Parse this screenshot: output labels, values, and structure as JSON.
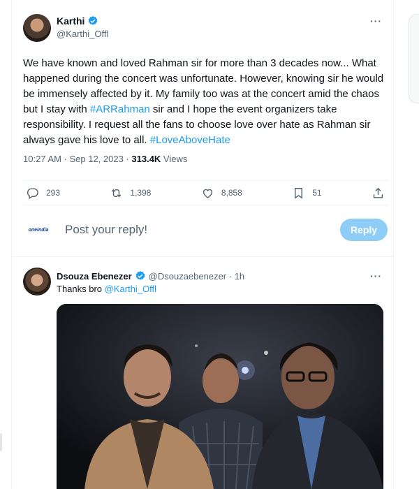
{
  "tweet": {
    "author_name": "Karthi",
    "handle": "@Karthi_Offl",
    "text_parts": [
      "We have known and loved Rahman sir for more than 3 decades now... What happened during the concert was unfortunate. However, knowing sir he would be immensely affected by it. My family too was at the concert amid the chaos but I stay with ",
      "#ARRahman",
      " sir and I hope the event organizers take responsibility. I request all the fans to choose love over hate as Rahman sir always gave his love to all. ",
      "#LoveAboveHate"
    ],
    "timestamp": "10:27 AM · Sep 12, 2023 · ",
    "views": "313.4K",
    "views_label": " Views",
    "more": "···",
    "actions": {
      "replies": "293",
      "reposts": "1,398",
      "likes": "8,858",
      "bookmarks": "51"
    }
  },
  "reply_box": {
    "logo_text": "oneindia",
    "placeholder": "Post your reply!",
    "button_label": "Reply"
  },
  "reply": {
    "author_name": "Dsouza Ebenezer",
    "handle_time": "@Dsouzaebenezer · 1h",
    "text": "Thanks bro ",
    "mention": "@Karthi_Offl",
    "more": "···"
  },
  "colors": {
    "accent": "#1d9bf0",
    "reply_button": "#8ecdf8",
    "muted": "#536471"
  }
}
